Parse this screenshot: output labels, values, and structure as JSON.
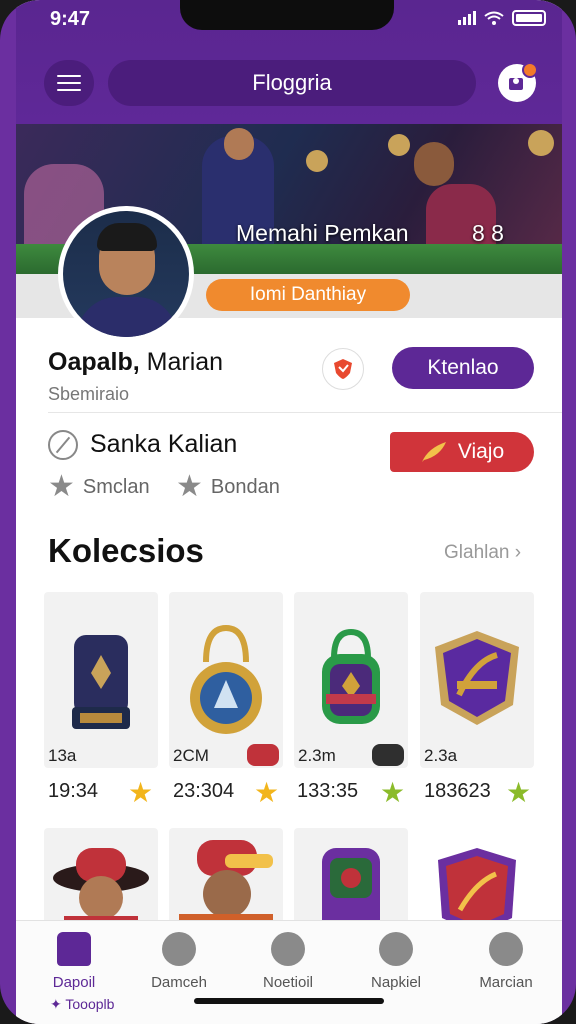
{
  "status": {
    "time": "9:47"
  },
  "header": {
    "title": "Floggria"
  },
  "banner": {
    "text": "Memahi Pemkan",
    "score": "8 8"
  },
  "profile": {
    "highlight_pill": "Iomi Danthiay",
    "name_bold": "Oapalb,",
    "name_rest": " Marian",
    "subtitle": "Sbemiraio",
    "follow_label": "Ktenlao"
  },
  "info": {
    "title": "Sanka Kalian",
    "badge_label": "Viajo",
    "meta": [
      "Smclan",
      "Bondan"
    ]
  },
  "collection": {
    "title": "Kolecsios",
    "see_all": "Glahlan",
    "items": [
      {
        "label": "13a",
        "score": "19:34",
        "star": "gold"
      },
      {
        "label": "2CM",
        "score": "23:304",
        "star": "gold"
      },
      {
        "label": "2.3m",
        "score": "133:35",
        "star": "green"
      },
      {
        "label": "2.3a",
        "score": "183623",
        "star": "green"
      }
    ]
  },
  "tabs": [
    {
      "label": "Dapoil",
      "icon": "home-icon",
      "active": true
    },
    {
      "label": "Damceh",
      "icon": "ball-icon",
      "active": false
    },
    {
      "label": "Noetioil",
      "icon": "notification-icon",
      "active": false
    },
    {
      "label": "Napkiel",
      "icon": "chat-icon",
      "active": false
    },
    {
      "label": "Marcian",
      "icon": "profile-icon",
      "active": false
    }
  ],
  "footnote": "Toooplb",
  "colors": {
    "primary": "#5d2896",
    "accent": "#f08a2e",
    "danger": "#d0343a",
    "star": "#f2b51c"
  }
}
